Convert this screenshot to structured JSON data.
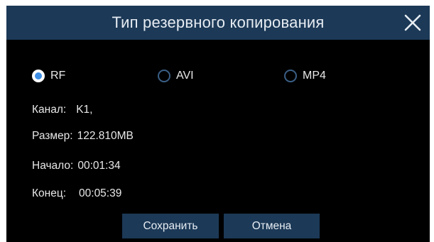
{
  "dialog": {
    "title": "Тип резервного копирования",
    "close_icon": "close-icon"
  },
  "backup_type": {
    "selected": "RF",
    "options": [
      {
        "label": "RF",
        "selected": true
      },
      {
        "label": "AVI",
        "selected": false
      },
      {
        "label": "MP4",
        "selected": false
      }
    ]
  },
  "info": {
    "channel": {
      "label": "Канал:",
      "value": "K1,"
    },
    "size": {
      "label": "Размер:",
      "value": "122.810MB"
    },
    "start": {
      "label": "Начало:",
      "value": "00:01:34"
    },
    "end": {
      "label": "Конец:",
      "value": "00:05:39"
    }
  },
  "buttons": {
    "save": "Сохранить",
    "cancel": "Отмена"
  },
  "colors": {
    "titlebar": "#1c3957",
    "background": "#000000",
    "accent": "#3d8ee5",
    "text": "#e8e8e8"
  }
}
